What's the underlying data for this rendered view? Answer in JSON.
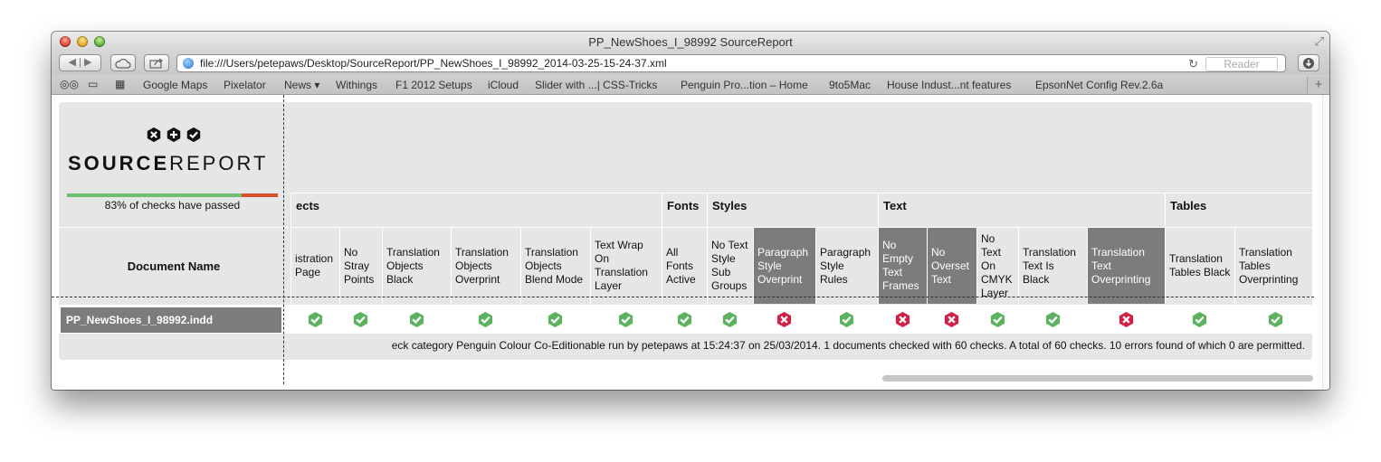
{
  "window": {
    "title": "PP_NewShoes_I_98992 SourceReport",
    "url": "file:///Users/petepaws/Desktop/SourceReport/PP_NewShoes_I_98992_2014-03-25-15-24-37.xml",
    "reader_label": "Reader"
  },
  "bookmarks": [
    "Google Maps",
    "Pixelator",
    "News ▾",
    "Withings",
    "F1 2012 Setups",
    "iCloud",
    "Slider with ...| CSS-Tricks",
    "Penguin Pro...tion – Home",
    "9to5Mac",
    "House Indust...nt features",
    "EpsonNet Config Rev.2.6a"
  ],
  "report": {
    "logo_bold": "SOURCE",
    "logo_light": "REPORT",
    "progress_fraction": 0.83,
    "progress_text": "83% of checks have passed",
    "doc_header": "Document Name",
    "categories": [
      "ects",
      "Fonts",
      "Styles",
      "Text",
      "Tables"
    ],
    "columns": [
      "istration Page",
      "No Stray Points",
      "Translation Objects Black",
      "Translation Objects Overprint",
      "Translation Objects Blend Mode",
      "Text Wrap On Translation Layer",
      "All Fonts Active",
      "No Text Style Sub Groups",
      "Paragraph Style Overprint",
      "Paragraph Style Rules",
      "No Empty Text Frames",
      "No Overset Text",
      "No Text On CMYK Layer",
      "Translation Text Is Black",
      "Translation Text Overprinting",
      "Translation Tables Black",
      "Translation Tables Overprinting"
    ],
    "document": "PP_NewShoes_I_98992.indd",
    "results": [
      "pass",
      "pass",
      "pass",
      "pass",
      "pass",
      "pass",
      "pass",
      "pass",
      "fail",
      "pass",
      "fail",
      "fail",
      "pass",
      "pass",
      "fail",
      "pass",
      "pass"
    ],
    "footer": "eck category Penguin Colour Co-Editionable run by petepaws at 15:24:37 on 25/03/2014. 1 documents checked with 60 checks. A total of 60 checks. 10 errors found of which 0 are permitted."
  }
}
